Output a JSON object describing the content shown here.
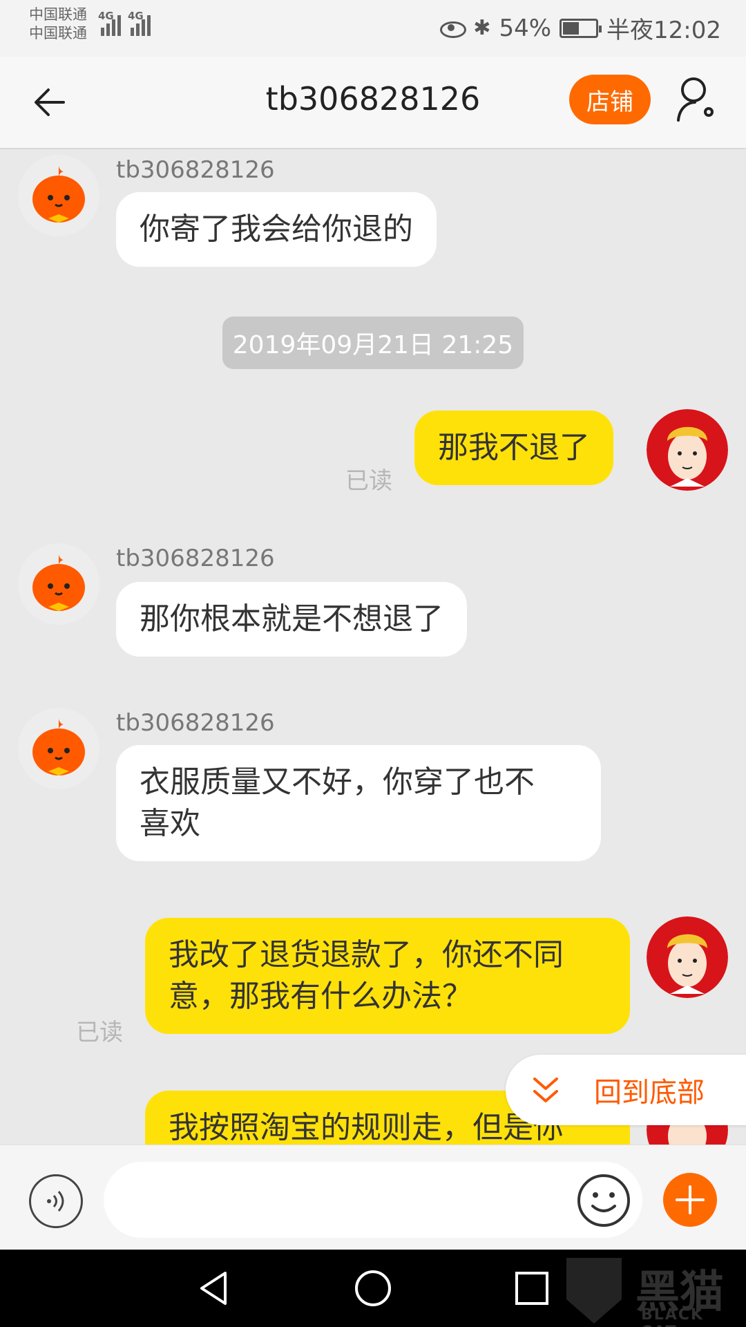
{
  "status_bar": {
    "carrier_1": "中国联通",
    "carrier_2": "中国联通",
    "network_1": "4G",
    "network_2": "4G",
    "battery_percent": "54%",
    "battery_level": 0.54,
    "time": "半夜12:02",
    "icons": [
      "eye-comfort-icon",
      "bluetooth-icon",
      "battery-icon"
    ]
  },
  "header": {
    "title": "tb306828126",
    "shop_label": "店铺",
    "icons": [
      "back-arrow-icon",
      "profile-settings-icon"
    ]
  },
  "messages": [
    {
      "side": "left",
      "sender": "tb306828126",
      "text": "你寄了我会给你退的"
    },
    {
      "type": "timestamp",
      "text": "2019年09月21日 21:25"
    },
    {
      "side": "right",
      "text": "那我不退了",
      "status": "已读"
    },
    {
      "side": "left",
      "sender": "tb306828126",
      "text": "那你根本就是不想退了"
    },
    {
      "side": "left",
      "sender": "tb306828126",
      "text_line1": "衣服质量又不好，你穿了也不",
      "text_line2": "喜欢"
    },
    {
      "side": "right",
      "text_line1": "我改了退货退款了，你还不同",
      "text_line2": "意，那我有什么办法？",
      "status": "已读"
    },
    {
      "side": "right",
      "text": "我按照淘宝的规则走，但是你"
    }
  ],
  "jump_to_bottom": {
    "label": "回到底部"
  },
  "input_bar": {
    "placeholder": "",
    "icons": [
      "voice-icon",
      "emoji-icon",
      "plus-icon"
    ]
  },
  "colors": {
    "accent": "#ff6a00",
    "my_bubble": "#ffe10a",
    "their_bubble": "#ffffff",
    "background": "#e9e9e9"
  },
  "watermark": {
    "main": "黑猫",
    "sub": "BLACK CAT"
  }
}
